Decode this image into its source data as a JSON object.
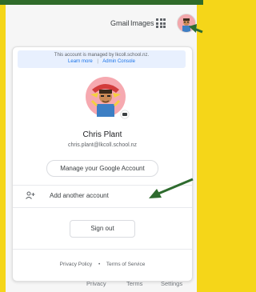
{
  "header": {
    "gmail_label": "Gmail",
    "images_label": "Images",
    "apps_icon": "apps-grid-icon",
    "avatar_icon": "account-avatar-icon"
  },
  "account_panel": {
    "managed_notice": "This account is managed by lkcoll.school.nz.",
    "learn_more_label": "Learn more",
    "separator": "|",
    "admin_console_label": "Admin Console",
    "name": "Chris Plant",
    "email": "chris.plant@lkcoll.school.nz",
    "manage_account_label": "Manage your Google Account",
    "add_account_label": "Add another account",
    "add_account_icon": "person-add-icon",
    "sign_out_label": "Sign out",
    "privacy_policy_label": "Privacy Policy",
    "footer_separator": "•",
    "terms_label": "Terms of Service"
  },
  "bottom_bar": {
    "privacy_label": "Privacy",
    "terms_label": "Terms",
    "settings_label": "Settings"
  },
  "colors": {
    "frame": "#f5d619",
    "frame_top": "#2f6b2a",
    "arrow": "#2e6b2e",
    "link_blue": "#1a73e8"
  }
}
